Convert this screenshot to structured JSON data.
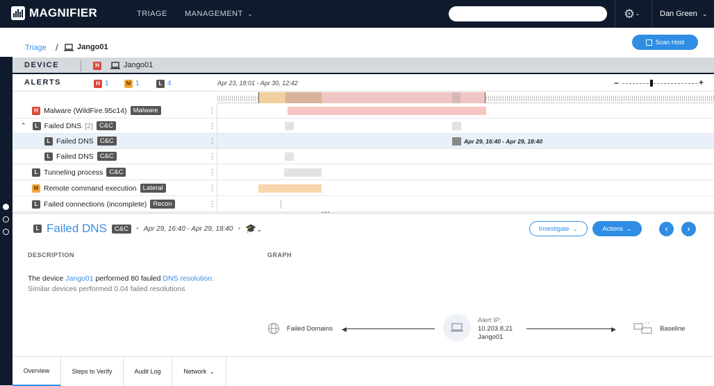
{
  "app": {
    "name": "MAGNIFIER"
  },
  "nav": {
    "triage": "TRIAGE",
    "management": "MANAGEMENT"
  },
  "user": {
    "name": "Dan Green"
  },
  "breadcrumb": {
    "root": "Triage",
    "current": "Jango01"
  },
  "scan_button": "Scan Host",
  "device": {
    "label": "DEVICE",
    "severity": "H",
    "name": "Jango01"
  },
  "alerts": {
    "label": "ALERTS",
    "counts": [
      {
        "severity": "H",
        "count": "1"
      },
      {
        "severity": "M",
        "count": "1"
      },
      {
        "severity": "L",
        "count": "4"
      }
    ],
    "range": "Apr 23, 18:01 - Apr 30, 12:42"
  },
  "rows": [
    {
      "severity": "H",
      "name": "Malware (WildFire.95c14)",
      "tag": "Malware"
    },
    {
      "severity": "L",
      "name": "Failed DNS",
      "count": "[2]",
      "tag": "C&C"
    },
    {
      "severity": "L",
      "name": "Failed DNS",
      "tag": "C&C",
      "range_label": "Apr 29, 16:40 - Apr 29, 18:40"
    },
    {
      "severity": "L",
      "name": "Failed DNS",
      "tag": "C&C"
    },
    {
      "severity": "L",
      "name": "Tunneling process",
      "tag": "C&C"
    },
    {
      "severity": "M",
      "name": "Remote command execution",
      "tag": "Lateral"
    },
    {
      "severity": "L",
      "name": "Failed connections (incomplete)",
      "tag": "Recon"
    }
  ],
  "detail": {
    "severity": "L",
    "title": "Failed DNS",
    "tag": "C&C",
    "range": "Apr 29, 16:40 - Apr 29, 18:40",
    "investigate": "Investigate",
    "actions": "Actions"
  },
  "description": {
    "header": "DESCRIPTION",
    "line1_pre": "The device ",
    "line1_device": "Jango01",
    "line1_mid": " performed 80 fauled ",
    "line1_link": "DNS resolution:",
    "line2": "Similar devices performed 0.04 failed resolutions"
  },
  "graph": {
    "header": "GRAPH",
    "left": "Failed Domains",
    "center_label": "Alert IP:",
    "center_ip": "10.203.8.21",
    "center_host": "Jango01",
    "right": "Baseline"
  },
  "tabs": [
    "Overview",
    "Steps to Verify",
    "Audit Log",
    "Network"
  ],
  "colors": {
    "accent": "#2f8de4",
    "high": "#d9483b",
    "medium": "#f3a73a",
    "low": "#555555",
    "navy": "#0f1b2d"
  }
}
